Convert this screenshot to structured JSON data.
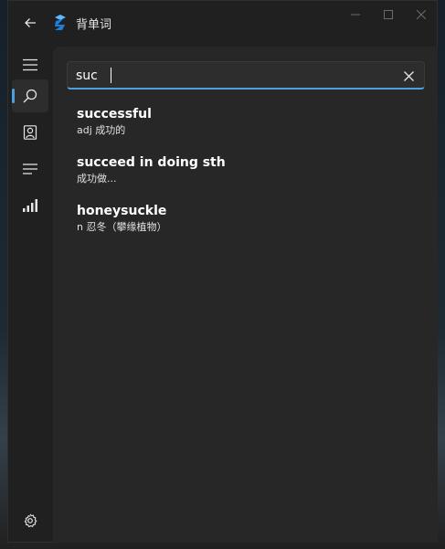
{
  "app": {
    "title": "背单词",
    "colors": {
      "accent": "#4ca0e0",
      "background": "#202020",
      "pane": "#272727"
    }
  },
  "window_controls": {
    "minimize_icon": "minimize-icon",
    "maximize_icon": "maximize-icon",
    "close_icon": "close-icon"
  },
  "nav": {
    "items": [
      {
        "icon": "hamburger-menu-icon"
      },
      {
        "icon": "search-icon",
        "active": true
      },
      {
        "icon": "contact-card-icon"
      },
      {
        "icon": "list-icon"
      },
      {
        "icon": "signal-bars-icon"
      }
    ],
    "settings_icon": "gear-icon"
  },
  "search": {
    "value": "suc",
    "placeholder": ""
  },
  "results": [
    {
      "word": "successful",
      "definition": "adj 成功的"
    },
    {
      "word": "succeed in doing sth",
      "definition": " 成功做..."
    },
    {
      "word": "honeysuckle",
      "definition": "n 忍冬（攀缘植物）"
    }
  ]
}
